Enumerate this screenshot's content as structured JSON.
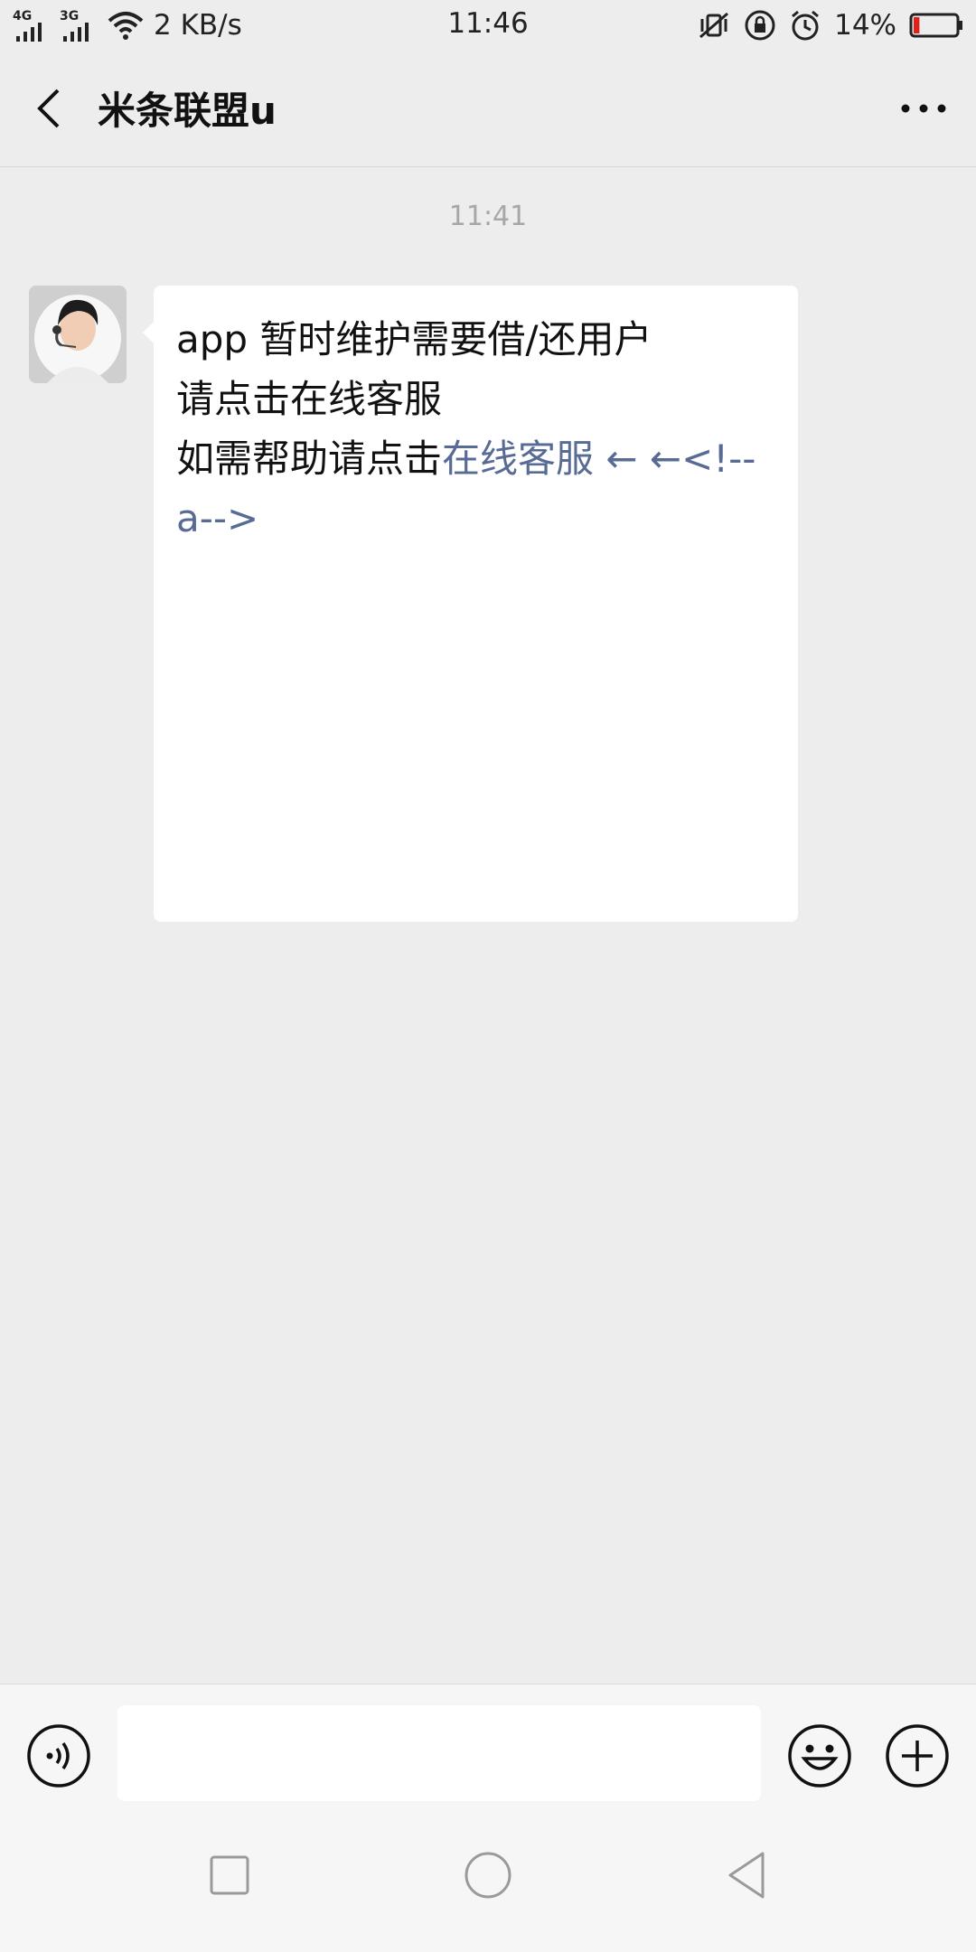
{
  "status_bar": {
    "network_1": "4G",
    "network_2": "3G",
    "speed": "2 KB/s",
    "time": "11:46",
    "battery_pct": "14%",
    "battery_level": 0.14
  },
  "nav": {
    "title": "米条联盟u"
  },
  "chat": {
    "timestamp": "11:41",
    "message_lines": [
      "app 暂时维护需要借/还用户",
      "",
      "",
      "请点击在线客服",
      "",
      "",
      "如需帮助请点击"
    ],
    "link_text": "在线客服",
    "link_tail": " ← ←<!--",
    "link_tail_2": "a-->"
  },
  "input": {
    "placeholder": "",
    "value": ""
  },
  "colors": {
    "background": "#ededed",
    "bubble": "#ffffff",
    "link": "#576b95",
    "battery_low": "#e0211b"
  }
}
